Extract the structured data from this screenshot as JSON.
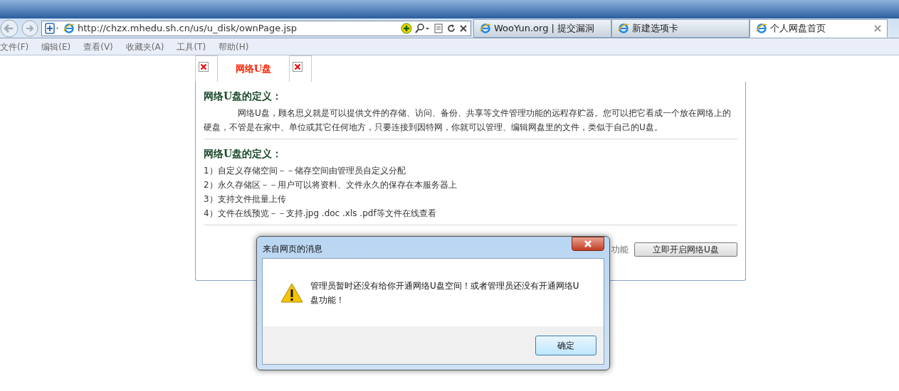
{
  "browser": {
    "address": "http://chzx.mhedu.sh.cn/us/u_disk/ownPage.jsp",
    "tabs": [
      {
        "label": "WooYun.org | 提交漏洞",
        "selected": false
      },
      {
        "label": "新建选项卡",
        "selected": false
      },
      {
        "label": "个人网盘首页",
        "selected": true
      }
    ],
    "menu": [
      "文件(F)",
      "编辑(E)",
      "查看(V)",
      "收藏夹(A)",
      "工具(T)",
      "帮助(H)"
    ]
  },
  "page": {
    "tabs": [
      {
        "kind": "broken_image"
      },
      {
        "kind": "text",
        "label": "网络U盘"
      },
      {
        "kind": "broken_image"
      }
    ],
    "sections": [
      {
        "kind": "paragraph",
        "heading": "网络U盘的定义：",
        "text": "网络U盘，顾名思义就是可以提供文件的存储、访问、备份、共享等文件管理功能的远程存贮器。您可以把它看成一个放在网络上的硬盘，不管是在家中、单位或其它任何地方，只要连接到因特网，你就可以管理、编辑网盘里的文件，类似于自己的U盘。"
      },
      {
        "kind": "list",
        "heading": "网络U盘的定义：",
        "items": [
          "1）自定义存储空间－－储存空间由管理员自定义分配",
          "2）永久存储区－－用户可以将资料、文件永久的保存在本服务器上",
          "3）支持文件批量上传",
          "4）文件在线预览－－支持.jpg .doc .xls .pdf等文件在线查看"
        ]
      }
    ],
    "footer": {
      "partial_text": "功能",
      "button": "立即开启网络U盘"
    }
  },
  "dialog": {
    "title": "来自网页的消息",
    "message": "管理员暂时还没有给你开通网络U盘空间！或者管理员还没有开通网络U盘功能！",
    "ok_button": "确定"
  }
}
